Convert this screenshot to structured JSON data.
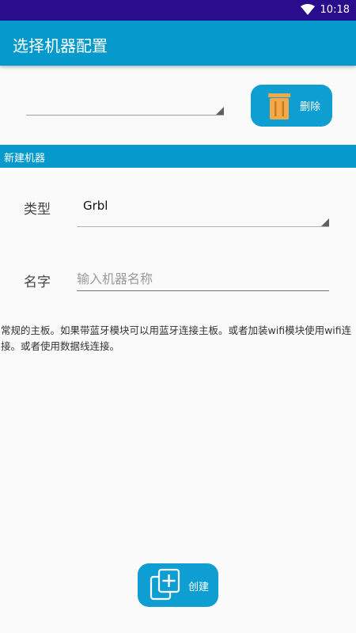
{
  "status_bar": {
    "time": "10:18"
  },
  "app_bar": {
    "title": "选择机器配置"
  },
  "machine_select": {
    "value": ""
  },
  "delete_button": {
    "label": "删除"
  },
  "section": {
    "title": "新建机器"
  },
  "type_field": {
    "label": "类型",
    "value": "Grbl"
  },
  "name_field": {
    "label": "名字",
    "placeholder": "输入机器名称",
    "value": ""
  },
  "description": "常规的主板。如果带蓝牙模块可以用蓝牙连接主板。或者加装wifi模块使用wifi连接。或者使用数据线连接。",
  "create_button": {
    "label": "创建"
  },
  "colors": {
    "status_bar": "#2a0d8d",
    "primary": "#0599cc",
    "button": "#0f9ed1",
    "trash_icon": "#f3a94a"
  },
  "icons": {
    "status": "wifi-icon",
    "delete": "trash-icon",
    "create": "add-copy-icon"
  }
}
